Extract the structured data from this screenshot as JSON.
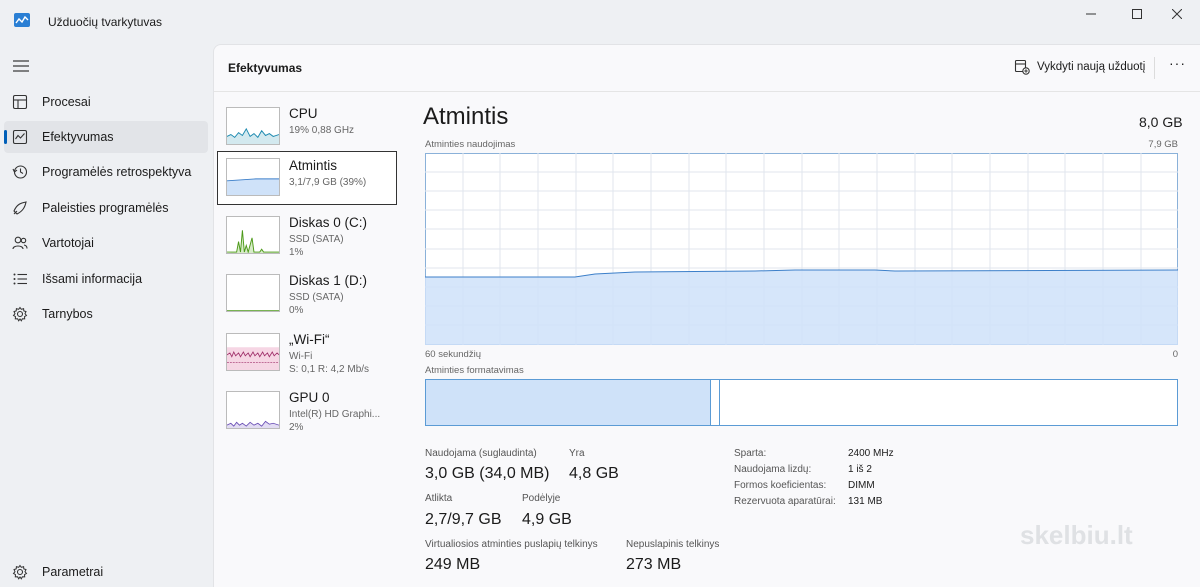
{
  "window": {
    "title": "Užduočių tvarkytuvas"
  },
  "sidebar": {
    "items": [
      {
        "label": "Procesai",
        "icon": "processes-icon"
      },
      {
        "label": "Efektyvumas",
        "icon": "performance-icon",
        "active": true
      },
      {
        "label": "Programėlės retrospektyva",
        "icon": "app-history-icon"
      },
      {
        "label": "Paleisties programėlės",
        "icon": "startup-apps-icon"
      },
      {
        "label": "Vartotojai",
        "icon": "users-icon"
      },
      {
        "label": "Išsami informacija",
        "icon": "details-icon"
      },
      {
        "label": "Tarnybos",
        "icon": "services-icon"
      }
    ],
    "settings_label": "Parametrai"
  },
  "header": {
    "title": "Efektyvumas",
    "run_task_label": "Vykdyti naują užduotį",
    "more_label": "···"
  },
  "perf_list": [
    {
      "name": "CPU",
      "sub1": "19% 0,88 GHz",
      "sub2": ""
    },
    {
      "name": "Atmintis",
      "sub1": "3,1/7,9 GB (39%)",
      "sub2": "",
      "selected": true
    },
    {
      "name": "Diskas 0 (C:)",
      "sub1": "SSD (SATA)",
      "sub2": "1%"
    },
    {
      "name": "Diskas 1 (D:)",
      "sub1": "SSD (SATA)",
      "sub2": "0%"
    },
    {
      "name": "„Wi-Fi“",
      "sub1": "Wi-Fi",
      "sub2": "S: 0,1 R: 4,2 Mb/s"
    },
    {
      "name": "GPU 0",
      "sub1": "Intel(R) HD Graphi...",
      "sub2": "2%"
    }
  ],
  "detail": {
    "title": "Atmintis",
    "total": "8,0 GB",
    "usage_label": "Atminties naudojimas",
    "usage_max": "7,9 GB",
    "time_left": "60 sekundžių",
    "time_right": "0",
    "composition_label": "Atminties formatavimas",
    "stats": {
      "in_use_label": "Naudojama (suglaudinta)",
      "in_use_value": "3,0 GB (34,0 MB)",
      "available_label": "Yra",
      "available_value": "4,8 GB",
      "committed_label": "Atlikta",
      "committed_value": "2,7/9,7 GB",
      "cached_label": "Podėlyje",
      "cached_value": "4,9 GB",
      "paged_label": "Virtualiosios atminties puslapių telkinys",
      "paged_value": "249 MB",
      "nonpaged_label": "Nepuslapinis telkinys",
      "nonpaged_value": "273 MB"
    },
    "specs": [
      {
        "key": "Sparta:",
        "value": "2400 MHz"
      },
      {
        "key": "Naudojama lizdų:",
        "value": "1 iš 2"
      },
      {
        "key": "Formos koeficientas:",
        "value": "DIMM"
      },
      {
        "key": "Rezervuota aparatūrai:",
        "value": "131 MB"
      }
    ]
  },
  "watermark": "skelbiu.lt",
  "colors": {
    "accent": "#005fb8",
    "memory_fill": "#cfe2f9",
    "memory_line": "#5b9bd5"
  }
}
